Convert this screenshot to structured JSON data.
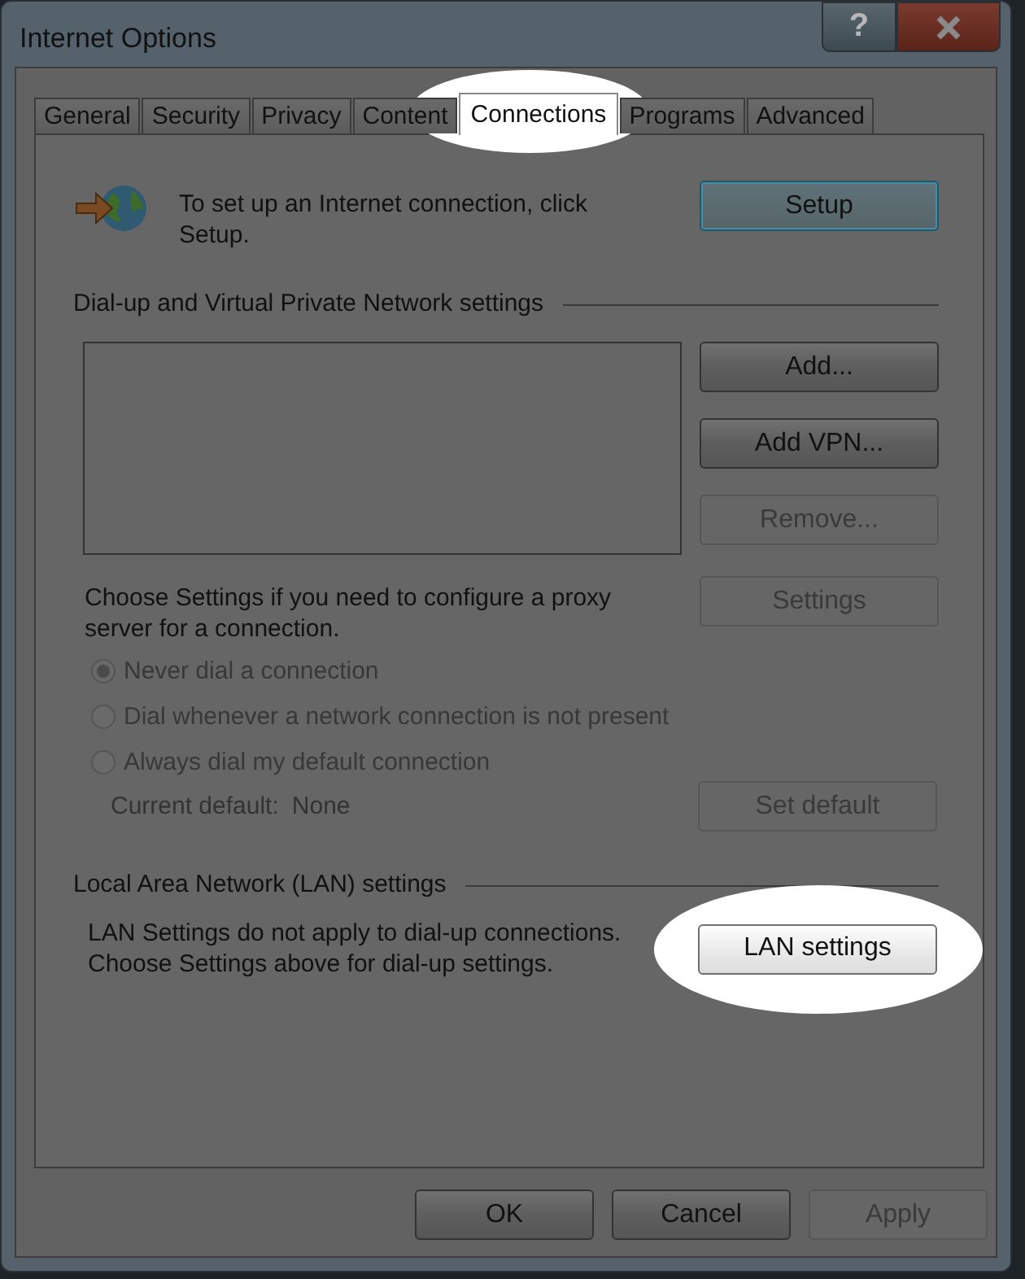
{
  "window": {
    "title": "Internet Options",
    "help_button": "?"
  },
  "tabs": [
    {
      "label": "General",
      "selected": false,
      "highlighted": false
    },
    {
      "label": "Security",
      "selected": false,
      "highlighted": false
    },
    {
      "label": "Privacy",
      "selected": false,
      "highlighted": false
    },
    {
      "label": "Content",
      "selected": false,
      "highlighted": false
    },
    {
      "label": "Connections",
      "selected": true,
      "highlighted": true
    },
    {
      "label": "Programs",
      "selected": false,
      "highlighted": false
    },
    {
      "label": "Advanced",
      "selected": false,
      "highlighted": false
    }
  ],
  "setup": {
    "text_lines": [
      "To set up an Internet connection, click",
      "Setup."
    ],
    "button": {
      "label": "Setup",
      "default": true,
      "disabled": false,
      "highlighted": false
    }
  },
  "dialup": {
    "heading": "Dial-up and Virtual Private Network settings",
    "buttons": [
      {
        "label": "Add...",
        "disabled": false,
        "highlighted": false
      },
      {
        "label": "Add VPN...",
        "disabled": false,
        "highlighted": false
      },
      {
        "label": "Remove...",
        "disabled": true,
        "highlighted": false
      }
    ],
    "proxy_text_lines": [
      "Choose Settings if you need to configure a proxy",
      "server for a connection."
    ],
    "settings_button": {
      "label": "Settings",
      "disabled": true,
      "highlighted": false
    },
    "radios": [
      {
        "label": "Never dial a connection",
        "selected": true,
        "disabled": true
      },
      {
        "label": "Dial whenever a network connection is not present",
        "selected": false,
        "disabled": true
      },
      {
        "label": "Always dial my default connection",
        "selected": false,
        "disabled": true
      }
    ],
    "current_default_label": "Current default:",
    "current_default_value": "None",
    "set_default_button": {
      "label": "Set default",
      "disabled": true,
      "highlighted": false
    }
  },
  "lan": {
    "heading": "Local Area Network (LAN) settings",
    "text_lines": [
      "LAN Settings do not apply to dial-up connections.",
      "Choose Settings above for dial-up settings."
    ],
    "button": {
      "label": "LAN settings",
      "disabled": false,
      "highlighted": true
    }
  },
  "footer_buttons": [
    {
      "label": "OK",
      "disabled": false,
      "highlighted": false
    },
    {
      "label": "Cancel",
      "disabled": false,
      "highlighted": false
    },
    {
      "label": "Apply",
      "disabled": true,
      "highlighted": false
    }
  ]
}
